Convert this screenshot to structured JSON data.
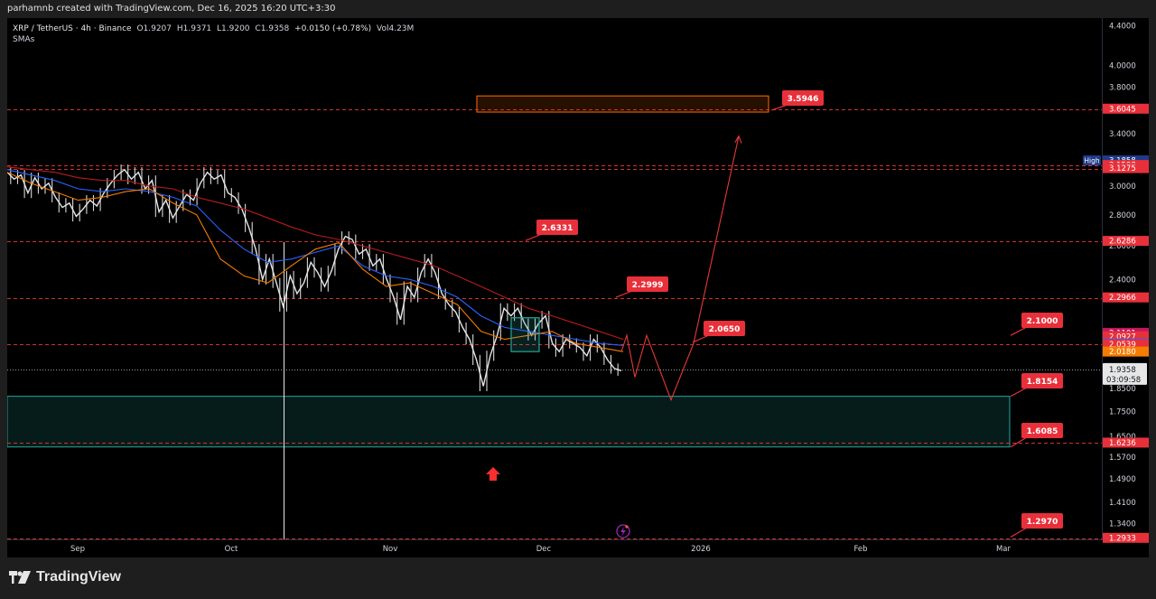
{
  "header": {
    "credit": "parhamnb created with TradingView.com, Dec 16, 2025 16:20 UTC+3:30"
  },
  "legend": {
    "symbol": "XRP / TetherUS · 4h · Binance",
    "open": "O1.9207",
    "high": "H1.9371",
    "low": "L1.9200",
    "close": "C1.9358",
    "change": "+0.0150 (+0.78%)",
    "volume": "Vol4.23M",
    "indicator": "SMAs"
  },
  "brand": {
    "name": "TradingView"
  },
  "colors": {
    "red_line": "#e53935",
    "sma_red": "#b71c1c",
    "sma_blue": "#2962ff",
    "sma_orange": "#f57c00",
    "zone_green": "#26a69a",
    "zone_orange": "#ff6d00",
    "badge_red": "#e8303a"
  },
  "chart_data": {
    "type": "line",
    "symbol": "XRP / TetherUS",
    "timeframe": "4h",
    "ylim": [
      1.29,
      4.48
    ],
    "y_scale": "log",
    "x_ticks": [
      "Sep",
      "Oct",
      "Nov",
      "Dec",
      "2026",
      "Feb",
      "Mar"
    ],
    "y_ticks": [
      "4.4000",
      "4.0000",
      "3.8000",
      "3.4000",
      "3.0000",
      "2.8000",
      "2.6000",
      "2.4000",
      "1.8500",
      "1.7500",
      "1.6500",
      "1.5700",
      "1.4900",
      "1.4100",
      "1.3400"
    ],
    "horizontal_levels": [
      "3.6045",
      "3.1508",
      "3.1275",
      "2.6286",
      "2.2966",
      "2.0539",
      "1.6236",
      "1.2933"
    ],
    "price_badges": [
      {
        "label": "3.6045",
        "value": 3.6045,
        "color": "#e8303a"
      },
      {
        "label": "High",
        "value": 3.1858,
        "color": "#1e3a8a",
        "price_text": "3.1858"
      },
      {
        "label": "3.1508",
        "value": 3.1508,
        "color": "#e8303a"
      },
      {
        "label": "3.1275",
        "value": 3.1275,
        "color": "#e8303a"
      },
      {
        "label": "2.6286",
        "value": 2.6286,
        "color": "#e8303a"
      },
      {
        "label": "2.2966",
        "value": 2.2966,
        "color": "#e8303a"
      },
      {
        "label": "2.1101",
        "value": 2.1101,
        "color": "#c2185b"
      },
      {
        "label": "2.0927",
        "value": 2.0927,
        "color": "#e8303a"
      },
      {
        "label": "2.0580",
        "value": 2.058,
        "color": "#2962ff"
      },
      {
        "label": "2.0539",
        "value": 2.0539,
        "color": "#e8303a"
      },
      {
        "label": "2.0180",
        "value": 2.018,
        "color": "#f57c00"
      },
      {
        "label": "1.6236",
        "value": 1.6236,
        "color": "#e8303a"
      },
      {
        "label": "1.2933",
        "value": 1.2933,
        "color": "#e8303a"
      }
    ],
    "last_price": {
      "price": "1.9358",
      "countdown": "03:09:58",
      "value": 1.9358
    },
    "callouts": [
      {
        "label": "3.5946",
        "value": 3.5946
      },
      {
        "label": "2.6331",
        "value": 2.6331
      },
      {
        "label": "2.2999",
        "value": 2.2999
      },
      {
        "label": "2.0650",
        "value": 2.065
      },
      {
        "label": "2.1000",
        "value": 2.1
      },
      {
        "label": "1.8154",
        "value": 1.8154
      },
      {
        "label": "1.6085",
        "value": 1.6085
      },
      {
        "label": "1.2970",
        "value": 1.297
      }
    ],
    "zones": [
      {
        "name": "demand",
        "from": 1.6085,
        "to": 1.8154,
        "color": "#26a69a"
      },
      {
        "name": "target",
        "from": 3.5946,
        "to": 3.72,
        "color": "#ff6d00"
      }
    ],
    "price_series": [
      3.1,
      3.05,
      3.08,
      2.95,
      3.06,
      2.98,
      3.02,
      2.92,
      2.85,
      2.88,
      2.79,
      2.84,
      2.9,
      2.86,
      2.95,
      3.02,
      3.08,
      3.12,
      3.05,
      3.1,
      2.98,
      3.04,
      2.82,
      2.9,
      2.78,
      2.86,
      2.94,
      2.9,
      3.02,
      3.1,
      3.05,
      3.08,
      2.95,
      2.92,
      2.84,
      2.72,
      2.58,
      2.4,
      2.52,
      2.38,
      2.25,
      2.42,
      2.32,
      2.38,
      2.5,
      2.44,
      2.36,
      2.45,
      2.58,
      2.66,
      2.64,
      2.55,
      2.58,
      2.48,
      2.52,
      2.4,
      2.3,
      2.18,
      2.36,
      2.3,
      2.44,
      2.52,
      2.44,
      2.32,
      2.26,
      2.22,
      2.14,
      2.08,
      1.98,
      1.86,
      2.0,
      2.1,
      2.24,
      2.2,
      2.24,
      2.16,
      2.1,
      2.16,
      2.2,
      2.06,
      2.02,
      2.08,
      2.06,
      2.04,
      2.0,
      2.08,
      2.04,
      1.98,
      1.94,
      1.93
    ],
    "sma_series": [
      {
        "name": "SMA",
        "color": "#b71c1c",
        "values": [
          3.14,
          3.12,
          3.1,
          3.06,
          3.04,
          3.04,
          3.0,
          2.98,
          2.92,
          2.88,
          2.84,
          2.78,
          2.72,
          2.67,
          2.64,
          2.6,
          2.56,
          2.52,
          2.48,
          2.42,
          2.36,
          2.3,
          2.24,
          2.2,
          2.16,
          2.12,
          2.08
        ]
      },
      {
        "name": "SMA",
        "color": "#2962ff",
        "values": [
          3.12,
          3.08,
          3.04,
          2.98,
          2.96,
          2.98,
          2.96,
          2.92,
          2.86,
          2.7,
          2.58,
          2.5,
          2.52,
          2.56,
          2.6,
          2.48,
          2.42,
          2.4,
          2.36,
          2.3,
          2.2,
          2.14,
          2.12,
          2.1,
          2.08,
          2.06,
          2.05
        ]
      },
      {
        "name": "SMA",
        "color": "#f57c00",
        "values": [
          3.1,
          3.02,
          2.96,
          2.9,
          2.92,
          2.96,
          2.98,
          2.88,
          2.8,
          2.52,
          2.42,
          2.38,
          2.48,
          2.58,
          2.62,
          2.46,
          2.36,
          2.38,
          2.32,
          2.26,
          2.12,
          2.08,
          2.1,
          2.12,
          2.06,
          2.04,
          2.02
        ]
      }
    ],
    "projection": [
      2.02,
      2.1,
      1.9,
      2.1,
      1.8,
      2.06,
      3.38
    ],
    "rising_arrow": "up-arrow"
  }
}
